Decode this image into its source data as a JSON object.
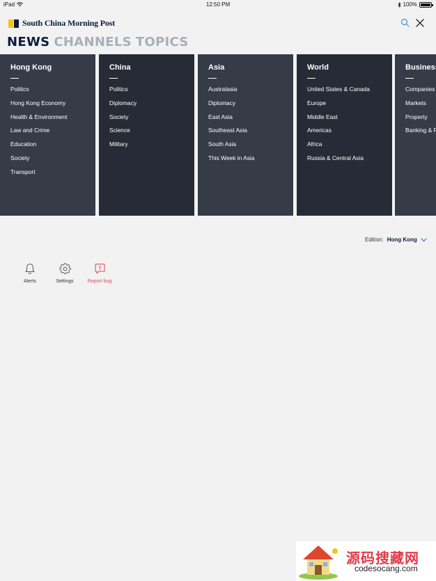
{
  "status_bar": {
    "device": "iPad",
    "time": "12:50 PM",
    "battery": "100%",
    "battery_level": 1.0
  },
  "header": {
    "logo_text": "South China Morning Post",
    "brand_colors": {
      "yellow": "#f5c518",
      "navy": "#0d1c3d"
    },
    "search_icon": "search-icon",
    "close_icon": "close-icon"
  },
  "nav": {
    "tabs": [
      {
        "label": "NEWS",
        "active": true
      },
      {
        "label": "CHANNELS",
        "active": false
      },
      {
        "label": "TOPICS",
        "active": false
      }
    ]
  },
  "categories": [
    {
      "title": "Hong Kong",
      "items": [
        "Politics",
        "Hong Kong Economy",
        "Health & Environment",
        "Law and Crime",
        "Education",
        "Society",
        "Transport"
      ]
    },
    {
      "title": "China",
      "items": [
        "Politics",
        "Diplomacy",
        "Society",
        "Science",
        "Military"
      ]
    },
    {
      "title": "Asia",
      "items": [
        "Australasia",
        "Diplomacy",
        "East Asia",
        "Southeast Asia",
        "South Asia",
        "This Week in Asia"
      ]
    },
    {
      "title": "World",
      "items": [
        "United States & Canada",
        "Europe",
        "Middle East",
        "Americas",
        "Africa",
        "Russia & Central Asia"
      ]
    },
    {
      "title": "Business",
      "items": [
        "Companies",
        "Markets",
        "Property",
        "Banking & Finance"
      ]
    }
  ],
  "edition": {
    "label": "Edition:",
    "value": "Hong Kong"
  },
  "actions": [
    {
      "label": "Alerts",
      "icon": "bell-icon"
    },
    {
      "label": "Settings",
      "icon": "gear-icon"
    },
    {
      "label": "Report bug",
      "icon": "report-bug-icon",
      "color": "#e0455a"
    }
  ],
  "watermark": {
    "text": "源码搜藏网",
    "url": "codesocang.com"
  }
}
